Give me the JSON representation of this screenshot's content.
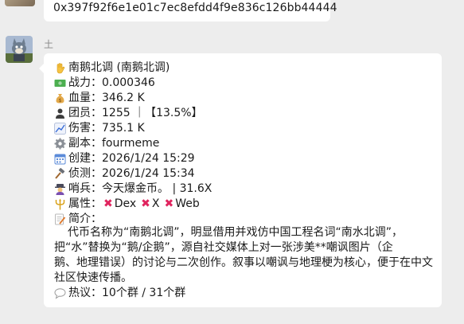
{
  "prev_message": {
    "text": "0x397f92f6e1e01c7ec8efdd4f9e836c126bb44444"
  },
  "message": {
    "sender": "土",
    "lines": {
      "name": "南鹅北调 (南鹅北调)",
      "power": "战力：0.000346",
      "blood": "血量：346.2 K",
      "team": "团员：1255 ｜【13.5%】",
      "damage": "伤害：735.1 K",
      "copy": "副本：fourmeme",
      "created": "创建：2026/1/24 15:29",
      "detected": "侦测：2026/1/24 15:34",
      "sentry": "哨兵：今天爆金币。 | 31.6X",
      "attr_label": "属性：",
      "attr_items": [
        "Dex",
        "X",
        "Web"
      ],
      "intro_label": "简介：",
      "heat": "热议：10个群 / 31个群"
    },
    "description": [
      "代币名称为“南鹅北调”，明显借用并戏仿中国工程名词“南水北调”，",
      "把“水”替换为“鹅/企鹅”，源自社交媒体上对一张涉美**嘲讽图片（企",
      "鹅、地理错误）的讨论与二次创作。叙事以嘲讽与地理梗为核心，便于在中文",
      "社区快速传播。"
    ]
  },
  "colors": {
    "background": "#ededed",
    "bubble": "#ffffff",
    "cross_icon": "#e0245e"
  }
}
